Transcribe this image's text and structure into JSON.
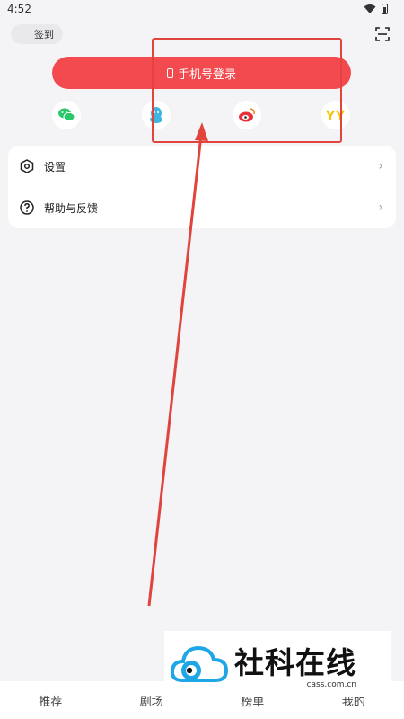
{
  "status_bar": {
    "time": "4:52"
  },
  "header": {
    "signin_label": "签到",
    "scan_icon": "scan-icon"
  },
  "login": {
    "phone_login_label": "手机号登录"
  },
  "social_logins": [
    {
      "name": "wechat",
      "color": "#2ac76b"
    },
    {
      "name": "qq",
      "color": "#3fb6e0"
    },
    {
      "name": "weibo",
      "color": "#e6333b"
    },
    {
      "name": "yy",
      "color": "#f5c400"
    }
  ],
  "menu": {
    "items": [
      {
        "label": "设置",
        "icon": "settings-icon"
      },
      {
        "label": "帮助与反馈",
        "icon": "help-icon"
      }
    ]
  },
  "bottom_nav": {
    "items": [
      {
        "label": "推荐"
      },
      {
        "label": "剧场"
      },
      {
        "label": "榜单"
      },
      {
        "label": "我的"
      }
    ]
  },
  "watermark": {
    "title": "社科在线",
    "url": "cass.com.cn"
  },
  "colors": {
    "accent": "#f24a4e",
    "annotation": "#e0443d",
    "background": "#f4f4f6"
  }
}
